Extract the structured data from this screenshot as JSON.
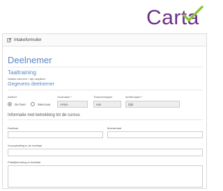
{
  "brand": {
    "name": "Carta",
    "accent": "#6b2f86",
    "check_color": "#8cc63f"
  },
  "panel": {
    "header_title": "Intakeformulier"
  },
  "page": {
    "title": "Deelnemer",
    "subtitle": "Taaltraining",
    "required_note": "Velden met een * zijn verplicht.",
    "section_participant": "Gegevens deelnemer",
    "section_course": "Informatie met betrekking tot de cursus"
  },
  "participant": {
    "gender_label": "Aanhef",
    "gender_options": [
      {
        "label": "De heer",
        "selected": true
      },
      {
        "label": "Mevrouw",
        "selected": false
      }
    ],
    "firstname_label": "Voornaam",
    "firstname_value": "Anton",
    "prefix_label": "Tussenvoegsel",
    "prefix_value": "van",
    "lastname_label": "Achternaam",
    "lastname_value": "Dijk"
  },
  "course": {
    "goal_label": "Doeltaal",
    "goal_value": "",
    "mother_label": "Moedertaal",
    "mother_value": "",
    "prior_education_label": "Vooropleiding in de doeltaal",
    "prior_education_value": "",
    "experience_label": "Praktijkervaring in doeltaal",
    "experience_value": ""
  }
}
